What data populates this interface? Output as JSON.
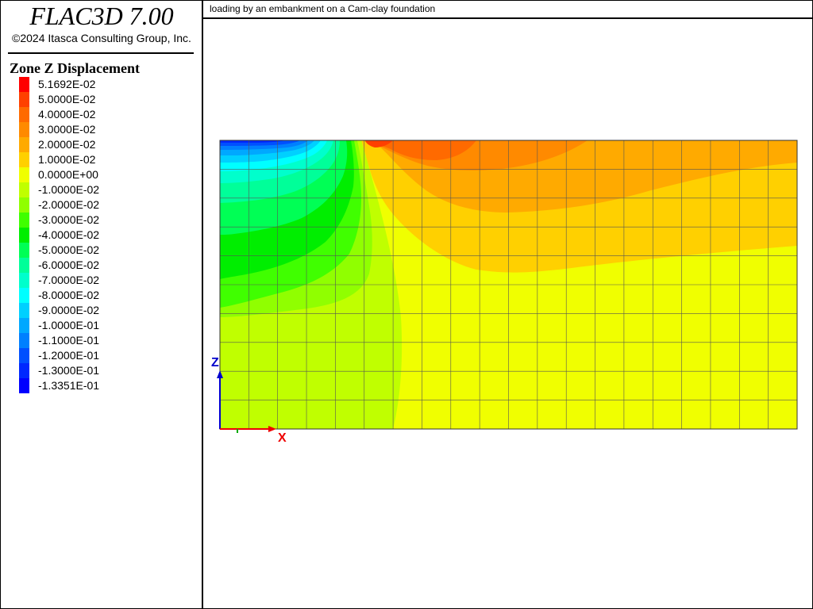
{
  "app": {
    "title": "FLAC3D 7.00",
    "copyright": "©2024 Itasca Consulting Group, Inc."
  },
  "caption": "loading by an embankment on a Cam-clay foundation",
  "legend": {
    "title": "Zone Z Displacement",
    "items": [
      {
        "label": "5.1692E-02",
        "color": "#ff0000"
      },
      {
        "label": "5.0000E-02",
        "color": "#ff4000"
      },
      {
        "label": "4.0000E-02",
        "color": "#ff6a00"
      },
      {
        "label": "3.0000E-02",
        "color": "#ff8a00"
      },
      {
        "label": "2.0000E-02",
        "color": "#ffaa00"
      },
      {
        "label": "1.0000E-02",
        "color": "#ffd000"
      },
      {
        "label": "0.0000E+00",
        "color": "#f0ff00"
      },
      {
        "label": "-1.0000E-02",
        "color": "#c0ff00"
      },
      {
        "label": "-2.0000E-02",
        "color": "#90ff00"
      },
      {
        "label": "-3.0000E-02",
        "color": "#40ff00"
      },
      {
        "label": "-4.0000E-02",
        "color": "#00ee00"
      },
      {
        "label": "-5.0000E-02",
        "color": "#00ff55"
      },
      {
        "label": "-6.0000E-02",
        "color": "#00ff99"
      },
      {
        "label": "-7.0000E-02",
        "color": "#00ffcc"
      },
      {
        "label": "-8.0000E-02",
        "color": "#00ffff"
      },
      {
        "label": "-9.0000E-02",
        "color": "#00d0ff"
      },
      {
        "label": "-1.0000E-01",
        "color": "#00a8ff"
      },
      {
        "label": "-1.1000E-01",
        "color": "#0080ff"
      },
      {
        "label": "-1.2000E-01",
        "color": "#0050ff"
      },
      {
        "label": "-1.3000E-01",
        "color": "#0028ff"
      },
      {
        "label": "-1.3351E-01",
        "color": "#0000ff"
      }
    ]
  },
  "axes": {
    "z_label": "Z",
    "x_label": "X",
    "z_color": "#0000cc",
    "x_color": "#ee0000",
    "y_color": "#00aa00"
  },
  "chart_data": {
    "type": "heatmap",
    "title": "Zone Z Displacement",
    "grid": true,
    "grid_columns": 20,
    "grid_rows": 10,
    "value_range": [
      -0.13351,
      0.051692
    ],
    "contour_levels": [
      0.051692,
      0.05,
      0.04,
      0.03,
      0.02,
      0.01,
      0.0,
      -0.01,
      -0.02,
      -0.03,
      -0.04,
      -0.05,
      -0.06,
      -0.07,
      -0.08,
      -0.09,
      -0.1,
      -0.11,
      -0.12,
      -0.13,
      -0.13351
    ]
  }
}
